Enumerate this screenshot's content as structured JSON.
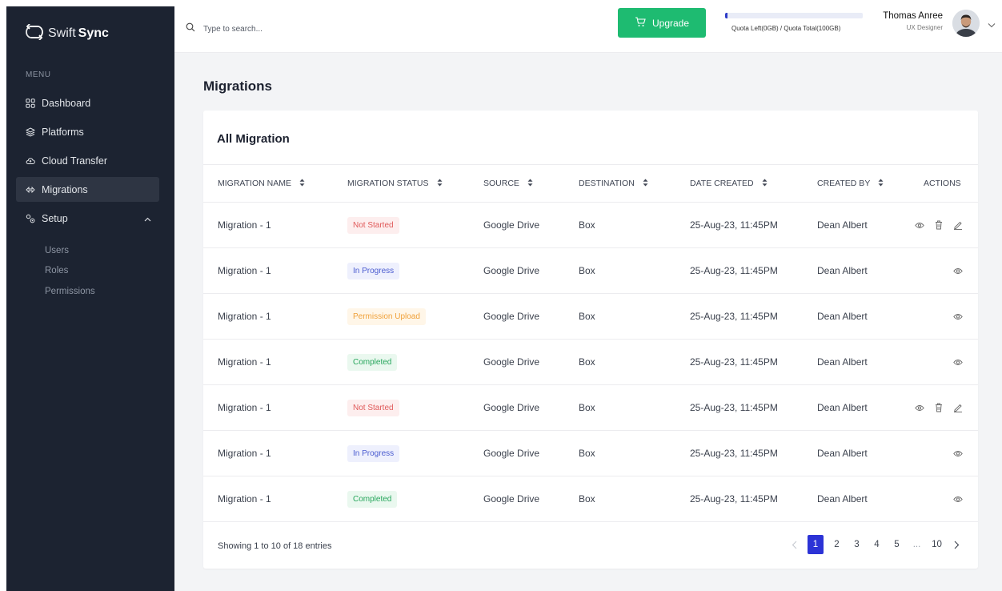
{
  "brand": {
    "light": "Swift",
    "bold": "Sync"
  },
  "sidebar": {
    "menu_title": "MENU",
    "items": [
      {
        "label": "Dashboard",
        "icon": "grid-icon"
      },
      {
        "label": "Platforms",
        "icon": "layers-icon"
      },
      {
        "label": "Cloud Transfer",
        "icon": "cloud-icon"
      },
      {
        "label": "Migrations",
        "icon": "migrate-icon",
        "active": true
      },
      {
        "label": "Setup",
        "icon": "setup-icon",
        "expanded": true
      }
    ],
    "subitems": [
      "Users",
      "Roles",
      "Permissions"
    ]
  },
  "header": {
    "search_placeholder": "Type to search...",
    "upgrade_label": "Upgrade",
    "quota_text": "Quota Left(0GB) / Quota Total(100GB)",
    "quota_used_fraction": 0.01,
    "user_name": "Thomas Anree",
    "user_role": "UX Designer"
  },
  "page": {
    "title": "Migrations",
    "card_title": "All Migration"
  },
  "table": {
    "columns": [
      "MIGRATION NAME",
      "MIGRATION STATUS",
      "SOURCE",
      "DESTINATION",
      "DATE CREATED",
      "CREATED BY",
      "ACTIONS"
    ],
    "rows": [
      {
        "name": "Migration - 1",
        "status": "Not Started",
        "status_kind": "not-started",
        "source": "Google Drive",
        "destination": "Box",
        "date": "25-Aug-23, 11:45PM",
        "created_by": "Dean Albert",
        "actions": [
          "view",
          "delete",
          "edit"
        ]
      },
      {
        "name": "Migration - 1",
        "status": "In Progress",
        "status_kind": "in-progress",
        "source": "Google Drive",
        "destination": "Box",
        "date": "25-Aug-23, 11:45PM",
        "created_by": "Dean Albert",
        "actions": [
          "view"
        ]
      },
      {
        "name": "Migration - 1",
        "status": "Permission Upload",
        "status_kind": "permission",
        "source": "Google Drive",
        "destination": "Box",
        "date": "25-Aug-23, 11:45PM",
        "created_by": "Dean Albert",
        "actions": [
          "view"
        ]
      },
      {
        "name": "Migration - 1",
        "status": "Completed",
        "status_kind": "completed",
        "source": "Google Drive",
        "destination": "Box",
        "date": "25-Aug-23, 11:45PM",
        "created_by": "Dean Albert",
        "actions": [
          "view"
        ]
      },
      {
        "name": "Migration - 1",
        "status": "Not Started",
        "status_kind": "not-started",
        "source": "Google Drive",
        "destination": "Box",
        "date": "25-Aug-23, 11:45PM",
        "created_by": "Dean Albert",
        "actions": [
          "view",
          "delete",
          "edit"
        ]
      },
      {
        "name": "Migration - 1",
        "status": "In Progress",
        "status_kind": "in-progress",
        "source": "Google Drive",
        "destination": "Box",
        "date": "25-Aug-23, 11:45PM",
        "created_by": "Dean Albert",
        "actions": [
          "view"
        ]
      },
      {
        "name": "Migration - 1",
        "status": "Completed",
        "status_kind": "completed",
        "source": "Google Drive",
        "destination": "Box",
        "date": "25-Aug-23, 11:45PM",
        "created_by": "Dean Albert",
        "actions": [
          "view"
        ]
      }
    ]
  },
  "footer": {
    "showing": "Showing 1 to 10 of 18 entries",
    "pages": [
      "1",
      "2",
      "3",
      "4",
      "5",
      "...",
      "10"
    ],
    "current_page": "1"
  },
  "colors": {
    "sidebar_bg": "#1c2331",
    "accent": "#2c33d6",
    "upgrade": "#1ebb71"
  }
}
